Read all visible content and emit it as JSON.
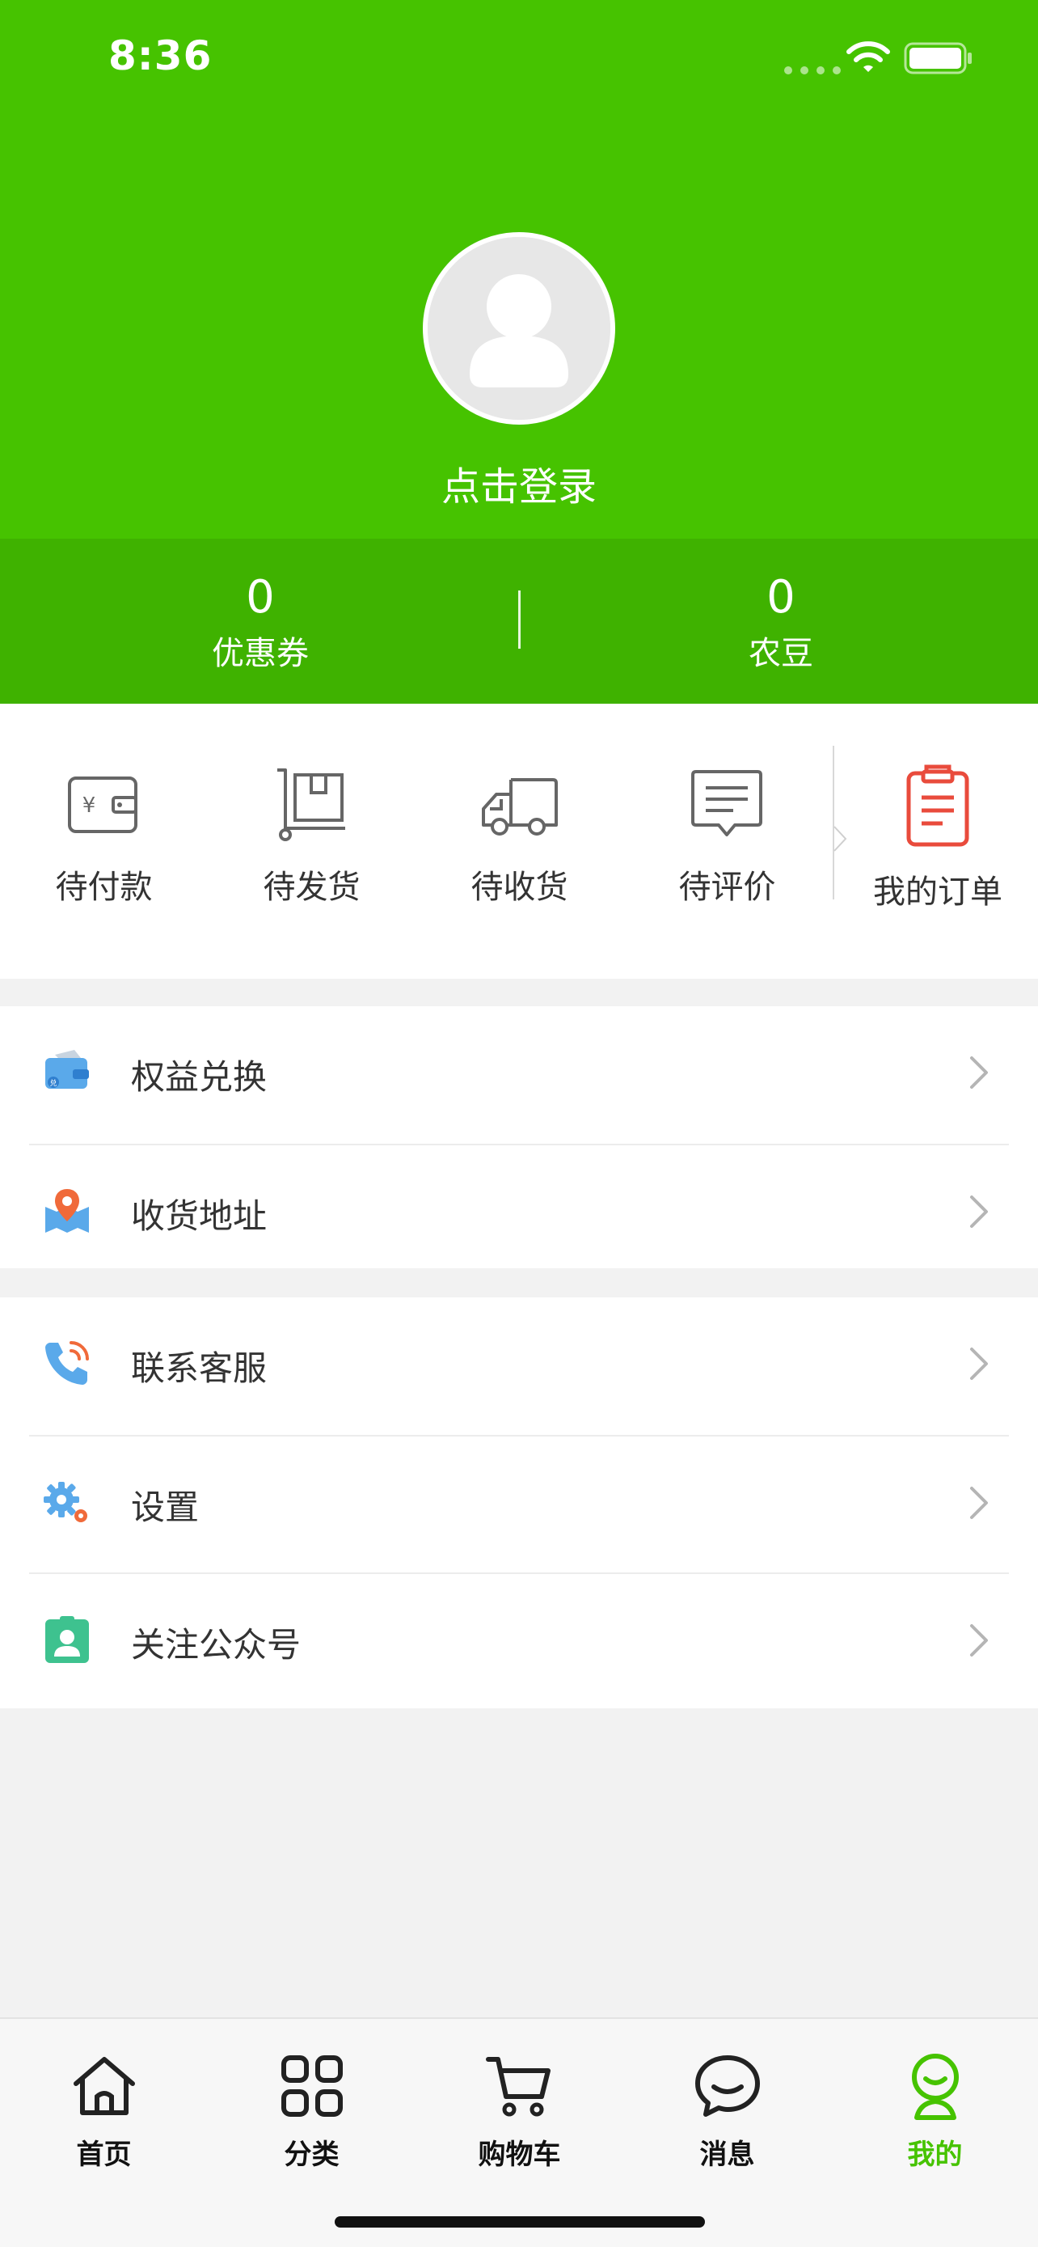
{
  "status_bar": {
    "time": "8:36"
  },
  "profile": {
    "login_label": "点击登录"
  },
  "stats": [
    {
      "value": "0",
      "label": "优惠券"
    },
    {
      "value": "0",
      "label": "农豆"
    }
  ],
  "orders": {
    "items": [
      {
        "label": "待付款",
        "icon": "wallet-yen-icon"
      },
      {
        "label": "待发货",
        "icon": "package-cart-icon"
      },
      {
        "label": "待收货",
        "icon": "delivery-truck-icon"
      },
      {
        "label": "待评价",
        "icon": "comment-icon"
      }
    ],
    "all_label": "我的订单",
    "all_icon": "clipboard-icon",
    "accent_color": "#e94b3c"
  },
  "menu": {
    "group1": [
      {
        "label": "权益兑换",
        "icon": "rewards-wallet-icon"
      },
      {
        "label": "收货地址",
        "icon": "map-pin-icon"
      }
    ],
    "group2": [
      {
        "label": "联系客服",
        "icon": "phone-icon"
      },
      {
        "label": "设置",
        "icon": "gear-icon"
      },
      {
        "label": "关注公众号",
        "icon": "badge-user-icon"
      }
    ]
  },
  "tabbar": {
    "items": [
      {
        "label": "首页",
        "icon": "home-icon"
      },
      {
        "label": "分类",
        "icon": "grid-icon"
      },
      {
        "label": "购物车",
        "icon": "cart-icon"
      },
      {
        "label": "消息",
        "icon": "chat-bubble-icon"
      },
      {
        "label": "我的",
        "icon": "profile-icon"
      }
    ],
    "active_index": 4
  },
  "colors": {
    "brand_green": "#46c300",
    "stats_green": "#3fb200",
    "background": "#f2f2f2",
    "text": "#333333"
  }
}
